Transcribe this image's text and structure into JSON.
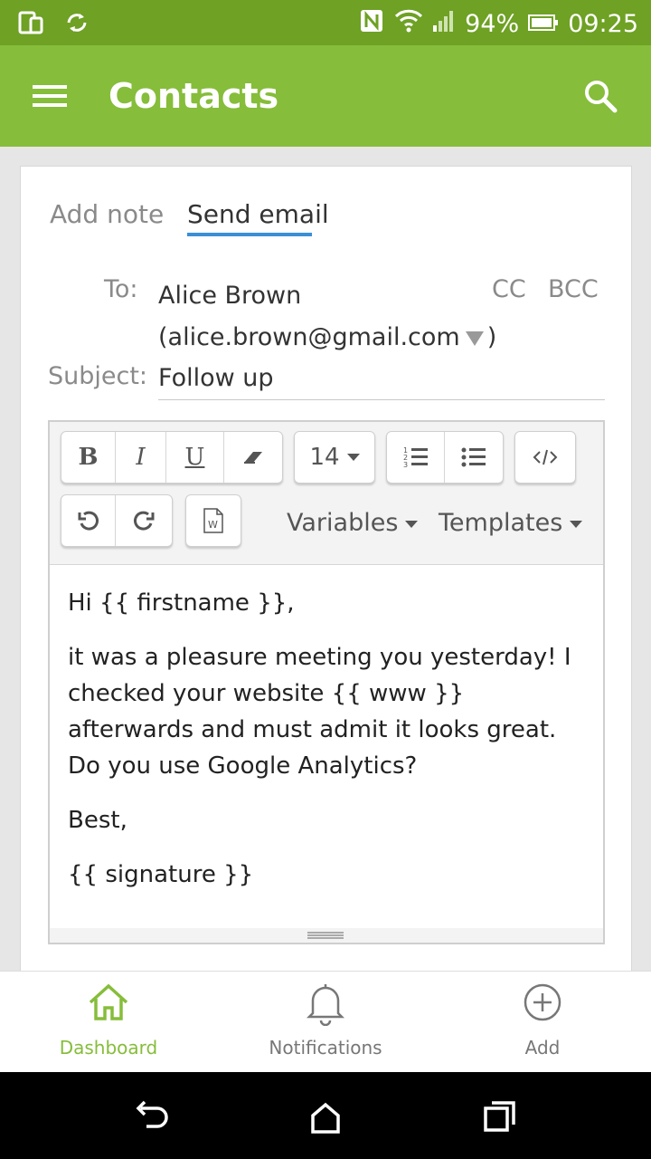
{
  "status_bar": {
    "battery": "94%",
    "time": "09:25"
  },
  "app_bar": {
    "title": "Contacts"
  },
  "tabs": [
    {
      "label": "Add note"
    },
    {
      "label": "Send email"
    }
  ],
  "email": {
    "to_label": "To:",
    "to_name": "Alice Brown",
    "to_address_open": "(alice.brown@gmail.com",
    "to_address_close": ")",
    "cc_label": "CC",
    "bcc_label": "BCC",
    "subject_label": "Subject:",
    "subject_value": "Follow up"
  },
  "toolbar": {
    "bold": "B",
    "italic": "I",
    "underline": "U",
    "font_size": "14",
    "variables_label": "Variables",
    "templates_label": "Templates"
  },
  "body": {
    "greeting": "Hi  {{ firstname }},",
    "paragraph": "it was a pleasure meeting you yesterday! I checked your website {{ www }} afterwards and must admit it looks great. Do you use Google Analytics?",
    "closing": "Best,",
    "signature": "{{ signature }}"
  },
  "bottom_nav": [
    {
      "label": "Dashboard",
      "icon": "home-icon",
      "active": true
    },
    {
      "label": "Notifications",
      "icon": "bell-icon",
      "active": false
    },
    {
      "label": "Add",
      "icon": "plus-circle-icon",
      "active": false
    }
  ],
  "colors": {
    "status_bar": "#6ea124",
    "app_bar": "#86bd3a",
    "tab_underline": "#3a8fd6",
    "active_nav": "#86bd3a"
  }
}
